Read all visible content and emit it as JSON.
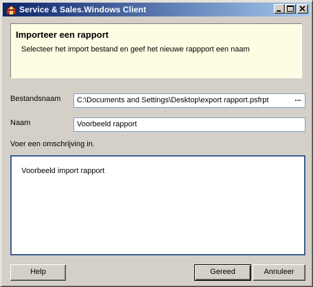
{
  "window": {
    "title": "Service & Sales.Windows Client",
    "controls": {
      "minimize": "minimize",
      "maximize": "maximize",
      "close": "close"
    }
  },
  "header": {
    "title": "Importeer een rapport",
    "description": "Selecteer het import bestand en geef het nieuwe rappport een naam",
    "background_color": "#fefde3"
  },
  "form": {
    "filename_label": "Bestandsnaam",
    "filename_value": "C:\\Documents and Settings\\Desktop\\export rapport.psfrpt",
    "browse_label": "...",
    "name_label": "Naam",
    "name_value": "Voorbeeld rapport",
    "description_label": "Voer een omschrijving in.",
    "description_value": "Voorbeeld import rapport"
  },
  "buttons": {
    "help": "Help",
    "ok": "Gereed",
    "cancel": "Annuleer"
  },
  "colors": {
    "titlebar_start": "#0a246a",
    "titlebar_end": "#a6caf0",
    "dialog_face": "#d4d0c8"
  }
}
